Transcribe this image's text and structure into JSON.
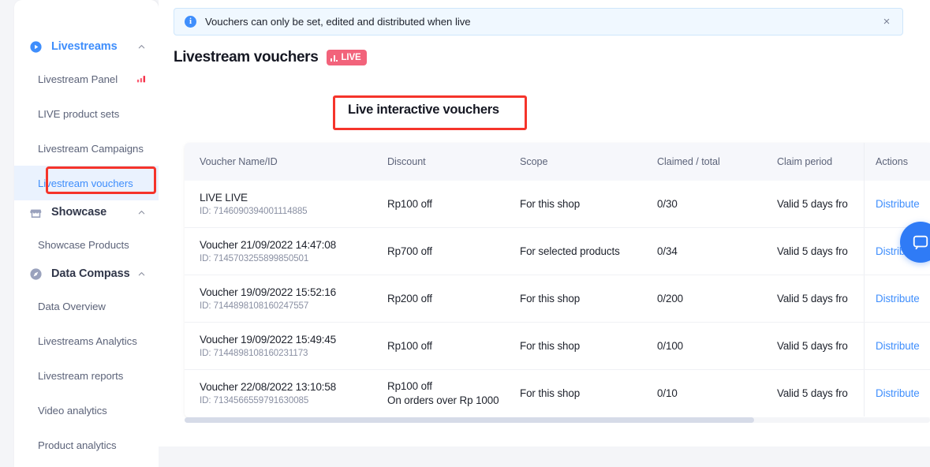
{
  "sidebar": {
    "groups": [
      {
        "id": "livestreams",
        "label": "Livestreams",
        "icon": "play-circle-icon",
        "active": true,
        "items": [
          {
            "label": "Livestream Panel",
            "trailing_icon": "bar-chart-icon",
            "selected": false
          },
          {
            "label": "LIVE product sets",
            "trailing_icon": "",
            "selected": false
          },
          {
            "label": "Livestream Campaigns",
            "trailing_icon": "",
            "selected": false
          },
          {
            "label": "Livestream vouchers",
            "trailing_icon": "",
            "selected": true
          }
        ]
      },
      {
        "id": "showcase",
        "label": "Showcase",
        "icon": "storefront-icon",
        "active": false,
        "items": [
          {
            "label": "Showcase Products",
            "trailing_icon": "",
            "selected": false
          }
        ]
      },
      {
        "id": "data-compass",
        "label": "Data Compass",
        "icon": "compass-icon",
        "active": false,
        "items": [
          {
            "label": "Data Overview",
            "trailing_icon": "",
            "selected": false
          },
          {
            "label": "Livestreams Analytics",
            "trailing_icon": "",
            "selected": false
          },
          {
            "label": "Livestream reports",
            "trailing_icon": "",
            "selected": false
          },
          {
            "label": "Video analytics",
            "trailing_icon": "",
            "selected": false
          },
          {
            "label": "Product analytics",
            "trailing_icon": "",
            "selected": false
          }
        ]
      }
    ]
  },
  "notice": {
    "icon": "info-icon",
    "text": "Vouchers can only be set, edited and distributed when live",
    "close_label": "×"
  },
  "header": {
    "title": "Livestream vouchers",
    "badge": {
      "label": "LIVE",
      "icon": "live-bars-icon",
      "color": "#f2637b"
    }
  },
  "section": {
    "title": "Live interactive vouchers"
  },
  "table": {
    "columns": [
      "Voucher Name/ID",
      "Discount",
      "Scope",
      "Claimed / total",
      "Claim period",
      "Actions"
    ],
    "rows": [
      {
        "name": "LIVE LIVE",
        "id": "ID: 7146090394001114885",
        "discount": "Rp100 off",
        "discount_sub": "",
        "scope": "For this shop",
        "claimed": "0/30",
        "period": "Valid 5 days fro",
        "action": "Distribute"
      },
      {
        "name": "Voucher 21/09/2022 14:47:08",
        "id": "ID: 7145703255899850501",
        "discount": "Rp700 off",
        "discount_sub": "",
        "scope": "For selected products",
        "claimed": "0/34",
        "period": "Valid 5 days fro",
        "action": "Distribute"
      },
      {
        "name": "Voucher 19/09/2022 15:52:16",
        "id": "ID: 7144898108160247557",
        "discount": "Rp200 off",
        "discount_sub": "",
        "scope": "For this shop",
        "claimed": "0/200",
        "period": "Valid 5 days fro",
        "action": "Distribute"
      },
      {
        "name": "Voucher 19/09/2022 15:49:45",
        "id": "ID: 7144898108160231173",
        "discount": "Rp100 off",
        "discount_sub": "",
        "scope": "For this shop",
        "claimed": "0/100",
        "period": "Valid 5 days fro",
        "action": "Distribute"
      },
      {
        "name": "Voucher 22/08/2022 13:10:58",
        "id": "ID: 7134566559791630085",
        "discount": "Rp100 off",
        "discount_sub": "On orders over Rp 1000",
        "scope": "For this shop",
        "claimed": "0/10",
        "period": "Valid 5 days fro",
        "action": "Distribute"
      }
    ]
  },
  "fab": {
    "icon": "chat-bubble-icon",
    "color": "#2f7bf6"
  },
  "accents": {
    "primary_blue": "#3f8efc",
    "annotation_red": "#f5342b",
    "live_pink": "#f2637b",
    "panel_bg": "#f4f5f8"
  }
}
